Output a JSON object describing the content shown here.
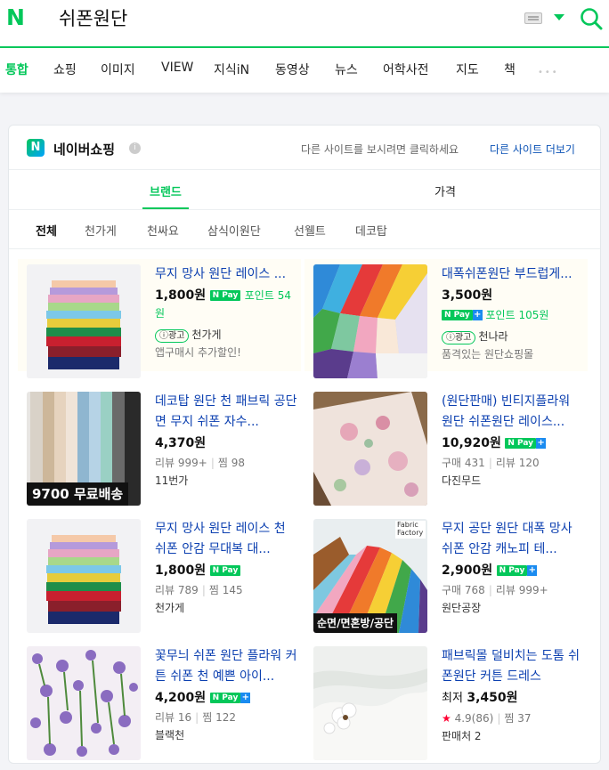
{
  "header": {
    "logo": "N",
    "query": "쉬폰원단",
    "colors": {
      "brand": "#03c75a",
      "link": "#0b3fb0"
    }
  },
  "tabs": [
    "통합",
    "쇼핑",
    "이미지",
    "VIEW",
    "지식iN",
    "동영상",
    "뉴스",
    "어학사전",
    "지도",
    "책"
  ],
  "more": "•••",
  "shopping": {
    "badge": "N",
    "title": "네이버쇼핑",
    "info_icon": "i",
    "other_text": "다른 사이트를 보시려면 클릭하세요",
    "other_link": "다른 사이트 더보기",
    "subtabs": [
      "브랜드",
      "가격"
    ],
    "chips": [
      "전체",
      "천가게",
      "천싸요",
      "삼식이원단",
      "선웰트",
      "데코탑"
    ],
    "products": [
      {
        "title": "무지 망사 원단 레이스 ...",
        "price": "1,800원",
        "pay": "N Pay",
        "point": "포인트 54원",
        "ad": "ⓘ광고",
        "seller": "천가게",
        "sub": "앱구매시 추가할인!",
        "thumb": "stack-fabric"
      },
      {
        "title": "대폭쉬폰원단 부드럽게...",
        "price": "3,500원",
        "pay": "N Pay",
        "plus": "+",
        "point": "포인트 105원",
        "ad": "ⓘ광고",
        "seller": "천나라",
        "sub": "품격있는 원단쇼핑몰",
        "thumb": "colorful-fold"
      },
      {
        "title": "데코탑 원단 천 패브릭 공단 면 무지 쉬폰 자수...",
        "price": "4,370원",
        "meta1": "리뷰 999+",
        "meta2": "찜 98",
        "seller": "11번가",
        "overlay": "9700 무료배송",
        "thumb": "rolls"
      },
      {
        "title": "(원단판매) 빈티지플라워 원단 쉬폰원단 레이스...",
        "price": "10,920원",
        "pay": "N Pay",
        "plus": "+",
        "meta1": "구매 431",
        "meta2": "리뷰 120",
        "seller": "다진무드",
        "thumb": "floral-table"
      },
      {
        "title": "무지 망사 원단 레이스 천 쉬폰 안감 무대복 대...",
        "price": "1,800원",
        "pay": "N Pay",
        "meta1": "리뷰 789",
        "meta2": "찜 145",
        "seller": "천가게",
        "thumb": "stack-fabric"
      },
      {
        "title": "무지 공단 원단 대폭 망사 쉬폰 안감 캐노피 테...",
        "price": "2,900원",
        "pay": "N Pay",
        "plus": "+",
        "meta1": "구매 768",
        "meta2": "리뷰 999+",
        "seller": "원단공장",
        "overlay": "순면/면혼방/공단",
        "factory": "Fabric Factory",
        "thumb": "rainbow-fan"
      },
      {
        "title": "꽃무늬 쉬폰 원단 플라워 커튼 쉬폰 천 예쁜 아이...",
        "price": "4,200원",
        "pay": "N Pay",
        "plus": "+",
        "meta1": "리뷰 16",
        "meta2": "찜 122",
        "seller": "블랙천",
        "thumb": "lilac-print"
      },
      {
        "title": "패브릭몰 덜비치는 도톰 쉬폰원단 커튼 드레스",
        "price_prefix": "최저",
        "price": "3,450원",
        "rating": "4.9(86)",
        "meta2": "찜 37",
        "seller": "판매처 2",
        "thumb": "white-cotton"
      }
    ]
  }
}
